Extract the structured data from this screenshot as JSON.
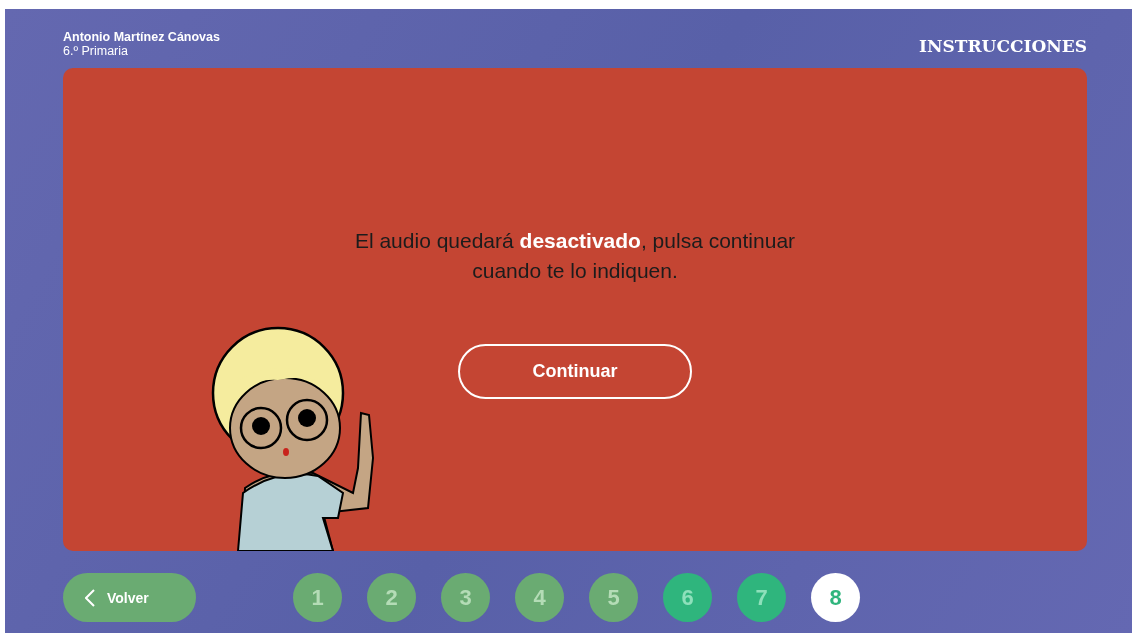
{
  "student": {
    "name": "Antonio Martínez Cánovas",
    "grade": "6.º Primaria"
  },
  "section_title": "INSTRUCCIONES",
  "message": "El audio quedará **desactivado**, pulsa continuar cuando te lo indiquen.",
  "continue_button": "Continuar",
  "back_button": "Volver",
  "steps": [
    {
      "label": "1",
      "completed": true,
      "selected": false
    },
    {
      "label": "2",
      "completed": true,
      "selected": false
    },
    {
      "label": "3",
      "completed": true,
      "selected": false
    },
    {
      "label": "4",
      "completed": true,
      "selected": false
    },
    {
      "label": "5",
      "completed": true,
      "selected": false
    },
    {
      "label": "6",
      "completed": false,
      "selected": false
    },
    {
      "label": "7",
      "completed": false,
      "selected": false
    },
    {
      "label": "8",
      "completed": false,
      "selected": true
    }
  ]
}
